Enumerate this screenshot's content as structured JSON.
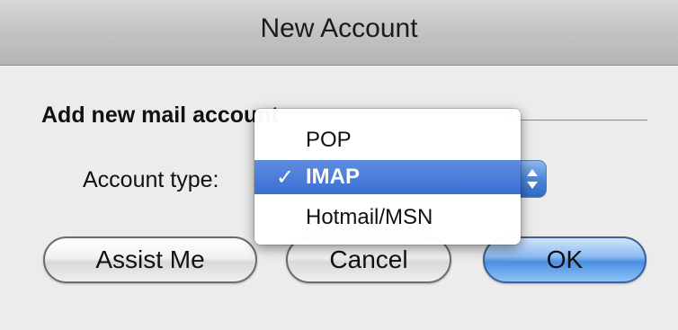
{
  "window": {
    "title": "New Account"
  },
  "form": {
    "section_heading": "Add new mail account",
    "account_type_label": "Account type:",
    "account_type_selected": "IMAP"
  },
  "menu": {
    "check_glyph": "✓",
    "items": [
      {
        "label": "POP",
        "selected": false
      },
      {
        "label": "IMAP",
        "selected": true
      },
      {
        "label": "Hotmail/MSN",
        "selected": false
      }
    ]
  },
  "buttons": {
    "assist_label": "Assist Me",
    "cancel_label": "Cancel",
    "ok_label": "OK"
  },
  "colors": {
    "menu_highlight": "#3a6fd2",
    "default_button": "#4b8fe2"
  },
  "icons": {
    "popup_arrows": "updown-arrows-icon"
  }
}
